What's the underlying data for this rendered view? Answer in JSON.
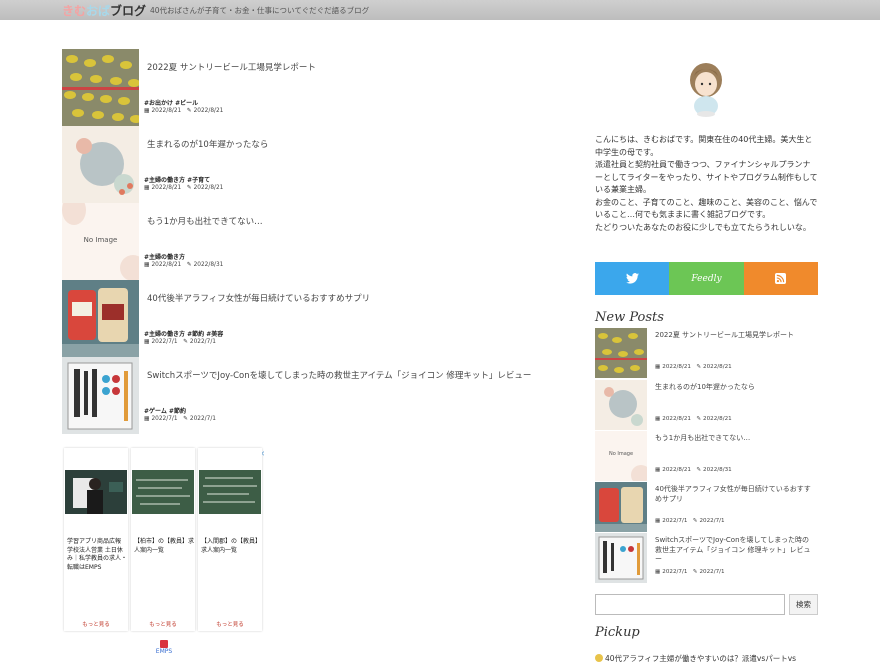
{
  "header": {
    "logo_part1": "きむ",
    "logo_part2": "おば",
    "logo_part3": "ブログ",
    "tagline": "40代おばさんが子育て・お金・仕事についてぐだぐだ語るブログ"
  },
  "posts": [
    {
      "title": "2022夏 サントリービール工場見学レポート",
      "tags": "#お出かけ #ビール",
      "published": "2022/8/21",
      "updated": "2022/8/21"
    },
    {
      "title": "生まれるのが10年遅かったなら",
      "tags": "#主婦の働き方 #子育て",
      "published": "2022/8/21",
      "updated": "2022/8/21"
    },
    {
      "title": "もう1か月も出社できてない…",
      "tags": "#主婦の働き方",
      "published": "2022/8/21",
      "updated": "2022/8/31",
      "thumb_label": "No Image"
    },
    {
      "title": "40代後半アラフィフ女性が毎日続けているおすすめサプリ",
      "tags": "#主婦の働き方 #節約 #美容",
      "published": "2022/7/1",
      "updated": "2022/7/1"
    },
    {
      "title": "SwitchスポーツでJoy-Conを壊してしまった時の救世主アイテム「ジョイコン 修理キット」レビュー",
      "tags": "#ゲーム #節約",
      "published": "2022/7/1",
      "updated": "2022/7/1"
    }
  ],
  "ad": {
    "cards": [
      {
        "text": "学習アプリ商品広報 学校法人営業 土日休み｜私学教員の求人・転職はEMPS",
        "more": "もっと見る"
      },
      {
        "text": "【柏市】の【教員】求人案内一覧",
        "more": "もっと見る"
      },
      {
        "text": "【入間郡】の【教員】求人案内一覧",
        "more": "もっと見る"
      }
    ],
    "brand": "EMPS",
    "close_icon": "ⓘ✕"
  },
  "sidebar": {
    "intro": "こんにちは、きむおばです。関東在住の40代主婦。美大生と中学生の母です。\n派遣社員と契約社員で働きつつ、ファイナンシャルプランナーとしてライターをやったり、サイトやプログラム制作もしている兼業主婦。\nお金のこと、子育てのこと、趣味のこと、美容のこと、悩んでいること…何でも気ままに書く雑記ブログです。\nたどりついたあなたのお役に少しでも立てたらうれしいな。",
    "social": {
      "twitter": "twitter-icon",
      "feedly": "Feedly",
      "rss": "rss-icon",
      "colors": {
        "twitter": "#3ba7ec",
        "feedly": "#6cc655",
        "rss": "#f08a2c"
      }
    },
    "new_posts_title": "New Posts",
    "new_posts": [
      {
        "title": "2022夏 サントリービール工場見学レポート",
        "published": "2022/8/21",
        "updated": "2022/8/21"
      },
      {
        "title": "生まれるのが10年遅かったなら",
        "published": "2022/8/21",
        "updated": "2022/8/21"
      },
      {
        "title": "もう1か月も出社できてない…",
        "published": "2022/8/21",
        "updated": "2022/8/31",
        "thumb_label": "No Image"
      },
      {
        "title": "40代後半アラフィフ女性が毎日続けているおすすめサプリ",
        "published": "2022/7/1",
        "updated": "2022/7/1"
      },
      {
        "title": "SwitchスポーツでJoy-Conを壊してしまった時の救世主アイテム「ジョイコン 修理キット」レビュー",
        "published": "2022/7/1",
        "updated": "2022/7/1"
      }
    ],
    "search_button": "検索",
    "pickup_title": "Pickup",
    "pickup_item": "40代アラフィフ主婦が働きやすいのは？派遣vsパートvs"
  }
}
